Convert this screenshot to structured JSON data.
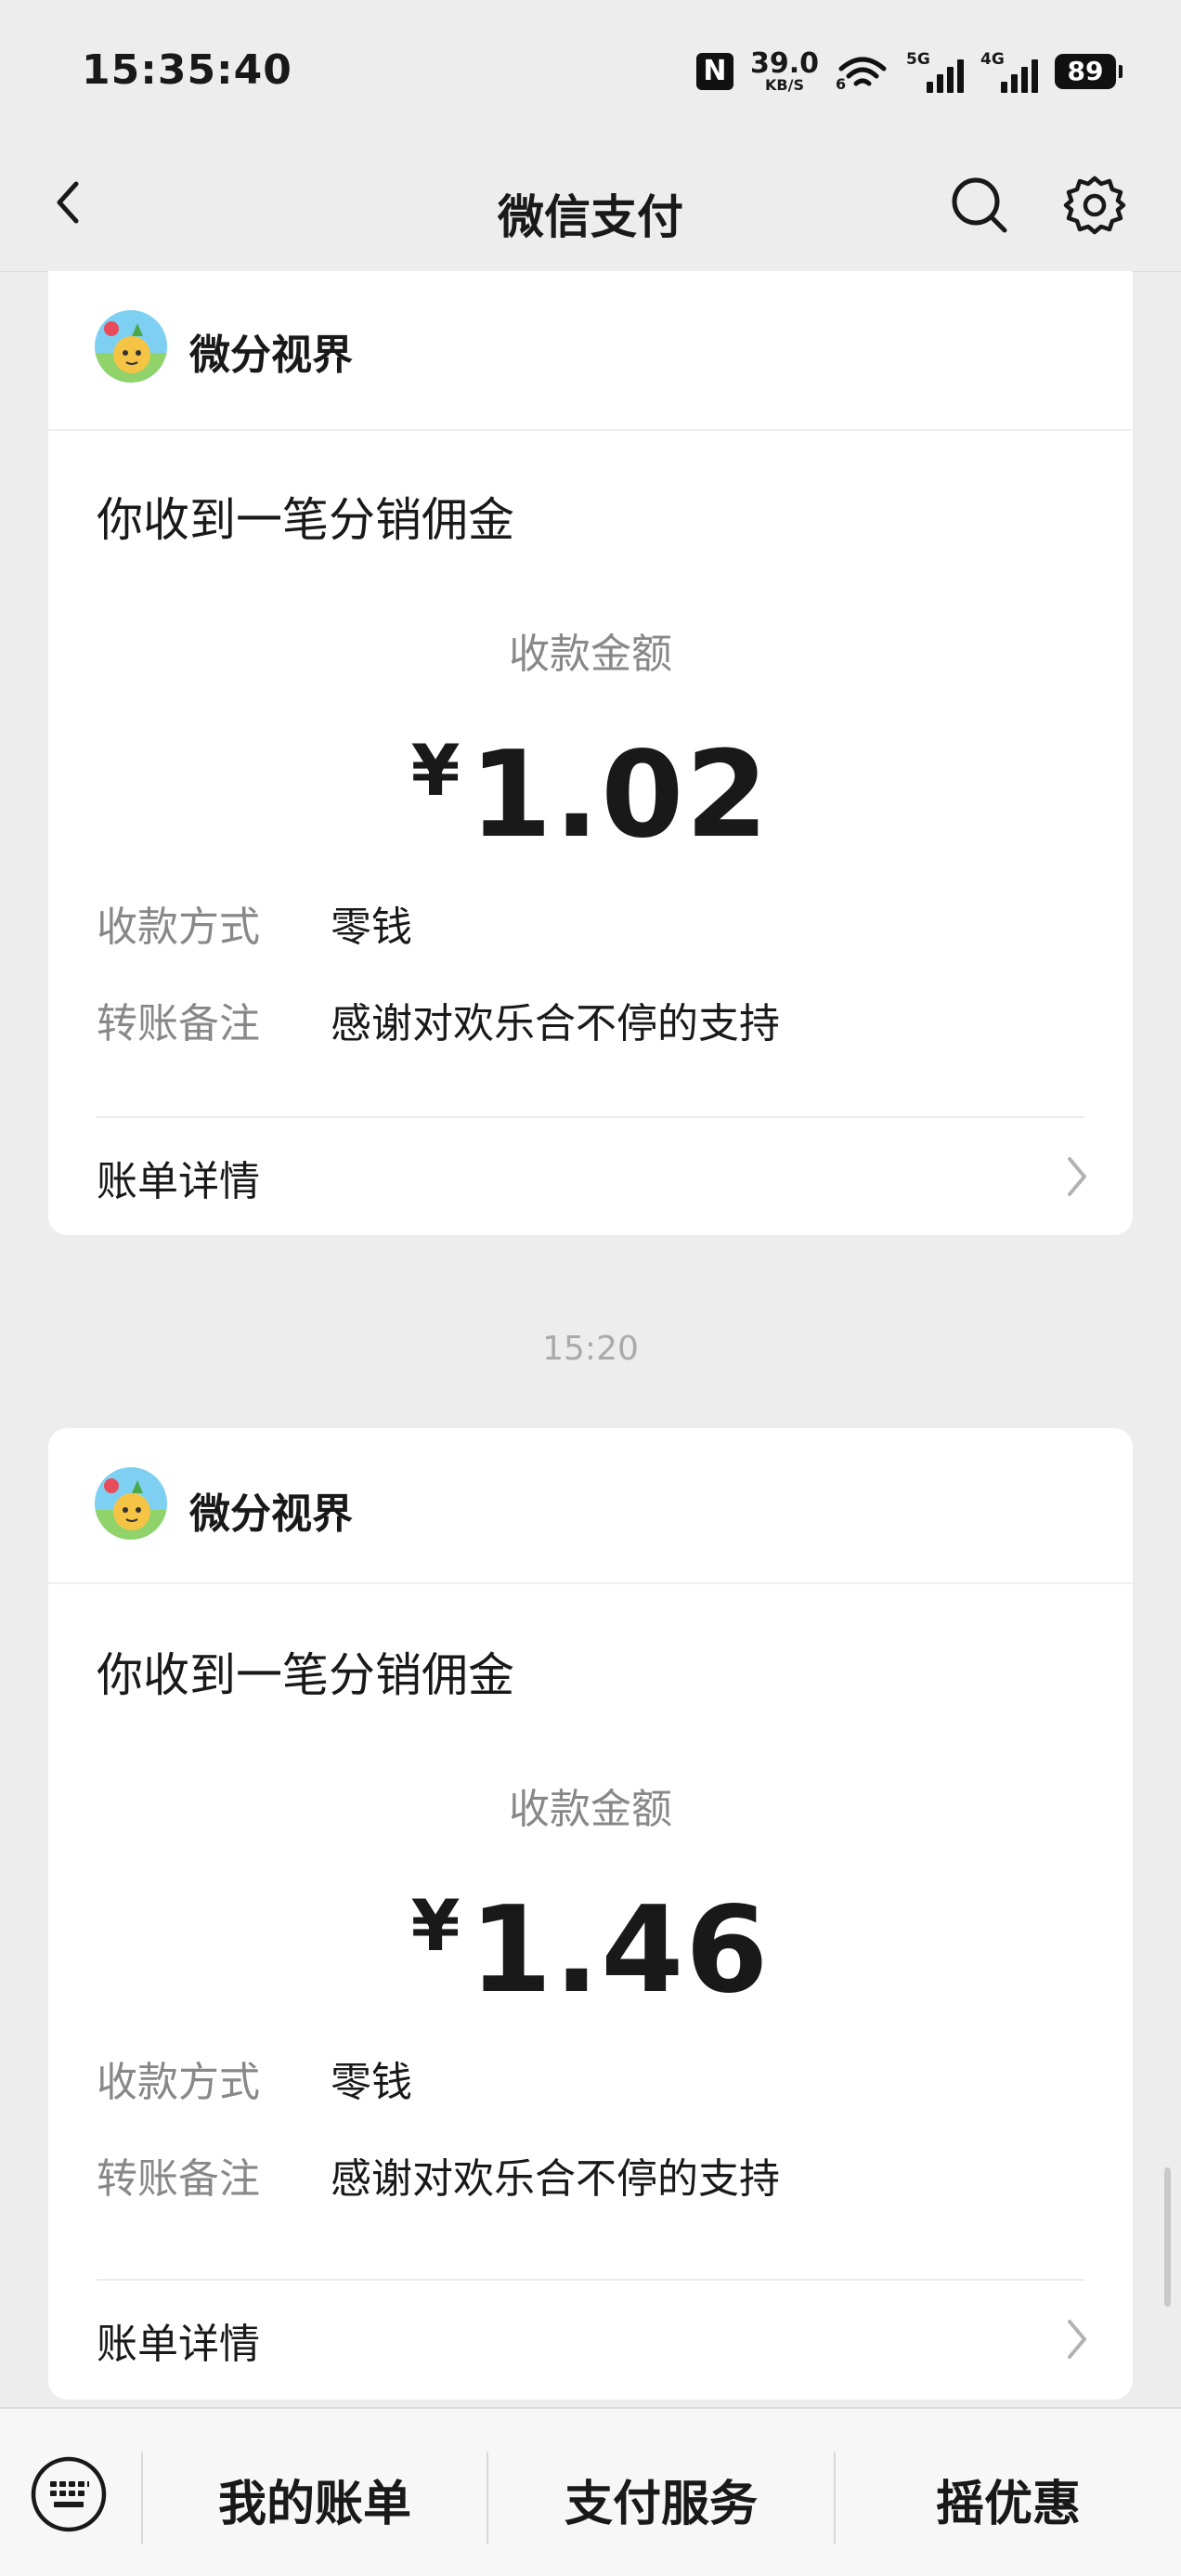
{
  "status_bar": {
    "time": "15:35:40",
    "nfc": "N",
    "speed_value": "39.0",
    "speed_unit": "KB/S",
    "wifi_tag": "6",
    "net1": "5G",
    "net2": "4G",
    "battery": "89"
  },
  "nav": {
    "title": "微信支付"
  },
  "cards": [
    {
      "merchant": "微分视界",
      "title": "你收到一笔分销佣金",
      "amount_label": "收款金额",
      "currency": "¥",
      "amount": "1.02",
      "method_label": "收款方式",
      "method_value": "零钱",
      "note_label": "转账备注",
      "note_value": "感谢对欢乐合不停的支持",
      "detail_label": "账单详情"
    },
    {
      "merchant": "微分视界",
      "title": "你收到一笔分销佣金",
      "amount_label": "收款金额",
      "currency": "¥",
      "amount": "1.46",
      "method_label": "收款方式",
      "method_value": "零钱",
      "note_label": "转账备注",
      "note_value": "感谢对欢乐合不停的支持",
      "detail_label": "账单详情"
    }
  ],
  "time_separator": "15:20",
  "bottom_bar": {
    "items": [
      "我的账单",
      "支付服务",
      "摇优惠"
    ]
  },
  "icons": {
    "back": "chevron-left-icon",
    "search": "search-icon",
    "settings": "gear-icon",
    "keyboard": "keyboard-icon",
    "chevron": "chevron-right-icon"
  }
}
